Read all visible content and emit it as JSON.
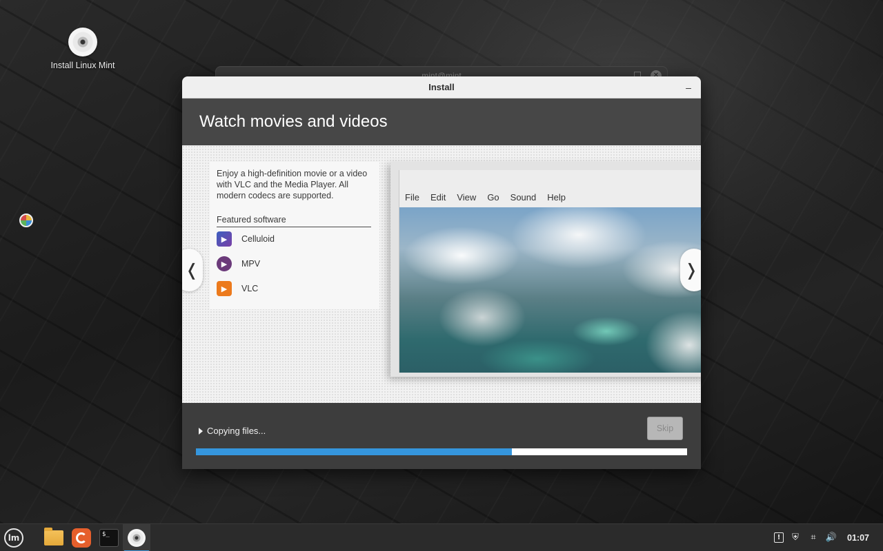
{
  "desktop": {
    "icons": [
      {
        "label": "Install Linux Mint",
        "icon": "disc-icon"
      }
    ]
  },
  "background_window": {
    "title": "mint@mint"
  },
  "installer": {
    "title": "Install",
    "minimize_label": "–",
    "slide": {
      "title": "Watch movies and videos",
      "description": "Enjoy a high-definition movie or a video with VLC and the Media Player. All modern codecs are supported.",
      "featured_heading": "Featured software",
      "apps": [
        {
          "label": "Celluloid",
          "icon": "celluloid-icon",
          "color": "#5b3fa0"
        },
        {
          "label": "MPV",
          "icon": "mpv-icon",
          "color": "#6b3a7a"
        },
        {
          "label": "VLC",
          "icon": "vlc-icon",
          "color": "#ec7a1c"
        }
      ],
      "player_menu": [
        "File",
        "Edit",
        "View",
        "Go",
        "Sound",
        "Help"
      ],
      "prev_label": "❬",
      "next_label": "❭"
    },
    "status": {
      "text": "Copying files...",
      "skip_label": "Skip",
      "progress": 0.643,
      "progress_color": "#3596dd"
    }
  },
  "taskbar": {
    "menu_icon": "linux-mint-menu-icon",
    "launchers": [
      {
        "name": "files",
        "icon": "folder-icon"
      },
      {
        "name": "firefox",
        "icon": "firefox-icon"
      },
      {
        "name": "terminal",
        "icon": "terminal-icon",
        "text": "$_"
      },
      {
        "name": "installer",
        "icon": "disc-icon",
        "active": true
      }
    ],
    "tray": [
      {
        "icon": "notes-icon",
        "glyph": "!"
      },
      {
        "icon": "update-shield-icon",
        "glyph": "⛨"
      },
      {
        "icon": "network-icon",
        "glyph": "⌗"
      },
      {
        "icon": "volume-icon",
        "glyph": "🔊"
      }
    ],
    "clock": "01:07"
  }
}
